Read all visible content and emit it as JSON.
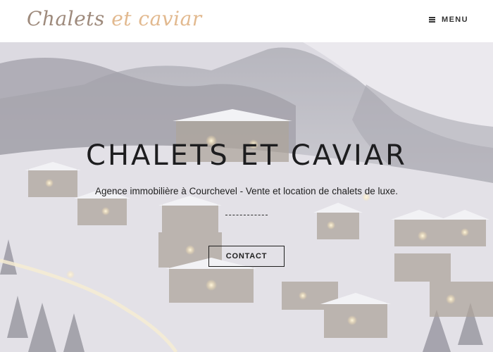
{
  "header": {
    "logo_part1": "Chalets",
    "logo_part2": "et caviar",
    "menu_label": "MENU",
    "logo_color": "#9e8a7c",
    "logo_accent_color": "#e2b98f"
  },
  "hero": {
    "title": "CHALETS ET CAVIAR",
    "subtitle": "Agence immobilière à Courchevel - Vente et location de chalets de luxe.",
    "cta_label": "CONTACT",
    "background": "snowy-alpine-village-at-dusk"
  },
  "icons": {
    "menu": "hamburger-icon"
  }
}
